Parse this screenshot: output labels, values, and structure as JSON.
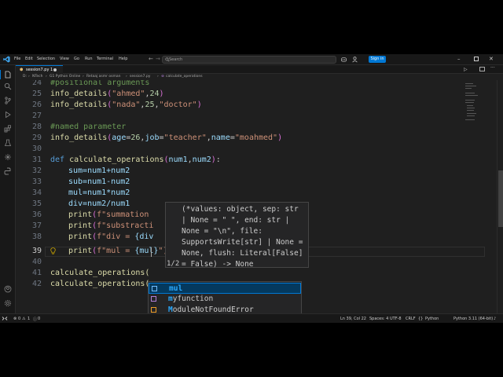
{
  "menu": [
    "File",
    "Edit",
    "Selection",
    "View",
    "Go",
    "Run",
    "Terminal",
    "Help"
  ],
  "search": {
    "placeholder": "Search"
  },
  "signin": "Sign in",
  "tab": {
    "label": "session7.py 1"
  },
  "breadcrumb": [
    "D:",
    "NTech",
    "G1 Python Online",
    "Retaaj asmr osman",
    "session7.py",
    "calculate_operations"
  ],
  "editor": {
    "line_numbers": [
      "24",
      "25",
      "26",
      "27",
      "28",
      "29",
      "30",
      "31",
      "32",
      "33",
      "34",
      "35",
      "36",
      "37",
      "38",
      "39",
      "40",
      "41",
      "42"
    ],
    "active_line": "39",
    "code": {
      "l24": "#positional arguments",
      "l25_fn": "info_details",
      "l25_a": "\"ahmed\"",
      "l25_b": "24",
      "l26_fn": "info_details",
      "l26_a": "\"nada\"",
      "l26_b": "25",
      "l26_c": "\"doctor\"",
      "l28": "#named parameter",
      "l29_fn": "info_details",
      "l29_k1": "age",
      "l29_v1": "26",
      "l29_k2": "job",
      "l29_v2": "\"teacher\"",
      "l29_k3": "name",
      "l29_v3": "\"moahmed\"",
      "l31_kw": "def",
      "l31_fn": "calculate_operations",
      "l31_p1": "num1",
      "l31_p2": "num2",
      "l32": "sum=num1+num2",
      "l33": "sub=num1-num2",
      "l34": "mul=num1*num2",
      "l35": "div=num2/num1",
      "l36_fn": "print",
      "l36_s": "f\"summation",
      "l37_fn": "print",
      "l37_s": "f\"substracti",
      "l38_fn": "print",
      "l38_s": "f\"div = ",
      "l38_v": "{div",
      "l39_fn": "print",
      "l39_s": "f\"mul = ",
      "l39_v": "{mul}",
      "l39_e": "\")",
      "l41": "calculate_operations(",
      "l42": "calculate_operations("
    }
  },
  "param_hint": {
    "lines": [
      "(*values: object, sep: str",
      "| None = \" \", end: str |",
      "None = \"\\n\", file:",
      "SupportsWrite[str] | None =",
      "None, flush: Literal[False]",
      "= False) -> None"
    ],
    "counter": "1/2"
  },
  "suggestions": [
    {
      "label": "mul",
      "match": "mul",
      "rest": "",
      "selected": true
    },
    {
      "label": "myfunction",
      "match": "m",
      "rest": "yfunction",
      "selected": false
    },
    {
      "label": "ModuleNotFoundError",
      "match": "M",
      "rest": "oduleNotFoundError",
      "selected": false
    }
  ],
  "status": {
    "errors": "0",
    "warnings": "1",
    "info": "0",
    "position": "Ln 39, Col 22",
    "spaces": "Spaces: 4",
    "encoding": "UTF-8",
    "eol": "CRLF",
    "language": "Python",
    "interpreter": "Python 3.11 (64-bit)"
  },
  "colors": {
    "accent": "#0078d4",
    "editor_bg": "#1f1f1f",
    "keyword": "#569cd6",
    "function": "#dcdcaa",
    "string": "#ce9178",
    "number": "#b5cea8",
    "comment": "#6a9955"
  },
  "icons": [
    "vscode-logo-icon",
    "explorer-icon",
    "search-icon",
    "source-control-icon",
    "run-debug-icon",
    "extensions-icon",
    "testing-icon",
    "python-icon",
    "copilot-icon",
    "account-icon",
    "settings-gear-icon",
    "lightbulb-icon"
  ]
}
